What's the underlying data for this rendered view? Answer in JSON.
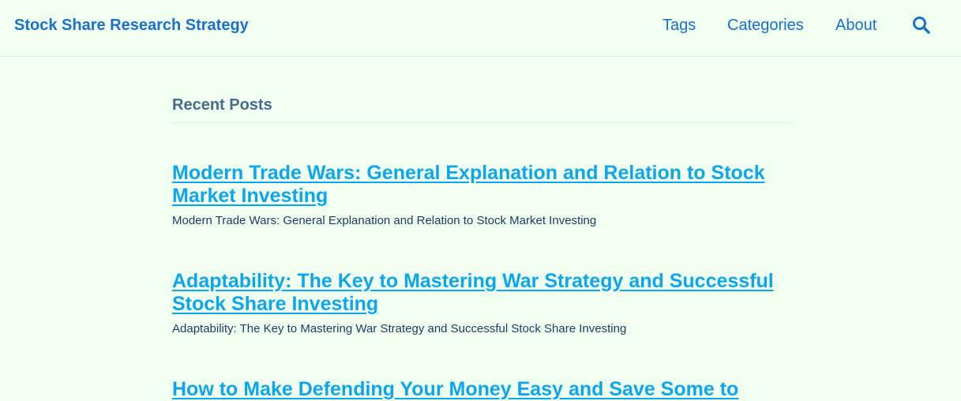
{
  "header": {
    "site_title": "Stock Share Research Strategy",
    "nav": [
      "Tags",
      "Categories",
      "About"
    ],
    "search_icon": "search-icon"
  },
  "main": {
    "section_title": "Recent Posts",
    "posts": [
      {
        "title": "Modern Trade Wars: General Explanation and Relation to Stock Market Investing",
        "summary": "Modern Trade Wars: General Explanation and Relation to Stock Market Investing"
      },
      {
        "title": "Adaptability: The Key to Mastering War Strategy and Successful Stock Share Investing",
        "summary": "Adaptability: The Key to Mastering War Strategy and Successful Stock Share Investing"
      },
      {
        "title": "How to Make Defending Your Money Easy and Save Some to"
      }
    ]
  },
  "colors": {
    "background": "#effff0",
    "header_link": "#1d6fc7",
    "post_link": "#0ea5e9",
    "summary_text": "#1f3b5a",
    "section_heading": "#4a6a8a"
  }
}
